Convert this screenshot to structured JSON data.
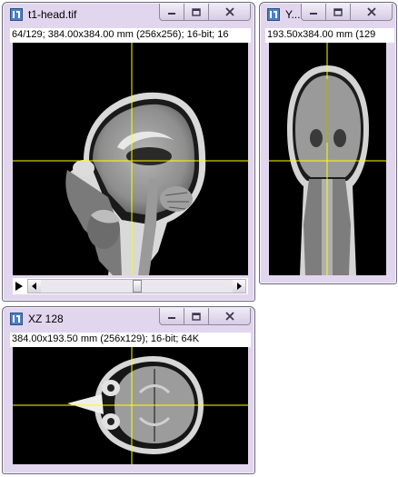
{
  "windows": {
    "xy": {
      "title": "t1-head.tif",
      "info": "64/129; 384.00x384.00 mm (256x256); 16-bit; 16",
      "scroll_position": 0.5
    },
    "yz": {
      "title": "Y...",
      "info": "193.50x384.00 mm (129"
    },
    "xz": {
      "title": "XZ 128",
      "info": "384.00x193.50 mm (256x129); 16-bit; 64K"
    }
  },
  "icons": {
    "app": "imagej-app-icon",
    "minimize": "minimize-icon",
    "maximize": "maximize-icon",
    "close": "close-icon",
    "play": "play-icon",
    "scroll_left": "chevron-left-icon",
    "scroll_right": "chevron-right-icon"
  },
  "colors": {
    "window_frame": "#e2d6ee",
    "crosshair": "#ffff00",
    "canvas": "#000000"
  }
}
